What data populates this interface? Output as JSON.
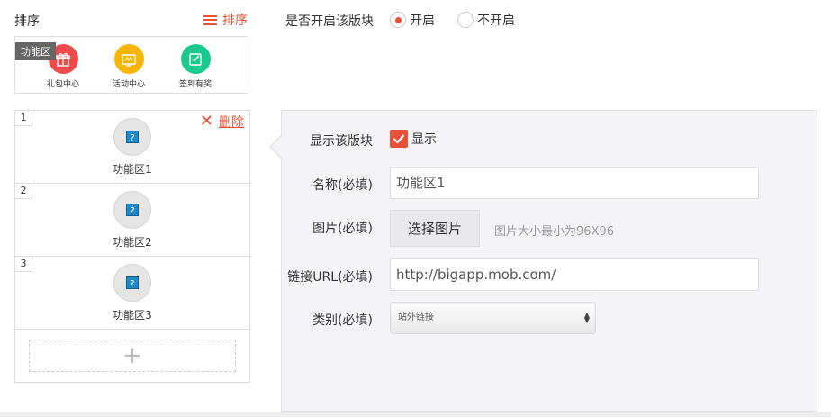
{
  "header": {
    "sort_title": "排序",
    "sort_button": "排序",
    "enable_label": "是否开启该版块",
    "radio_on": "开启",
    "radio_off": "不开启"
  },
  "preview": {
    "tag": "功能区",
    "items": [
      {
        "label": "礼包中心",
        "color": "#f04a4a",
        "icon": "gift-icon"
      },
      {
        "label": "活动中心",
        "color": "#f7b500",
        "icon": "activity-icon"
      },
      {
        "label": "签到有奖",
        "color": "#1bc98e",
        "icon": "edit-icon"
      }
    ]
  },
  "list": {
    "delete_label": "删除",
    "items": [
      {
        "num": "1",
        "name": "功能区1"
      },
      {
        "num": "2",
        "name": "功能区2"
      },
      {
        "num": "3",
        "name": "功能区3"
      }
    ],
    "add_symbol": "+"
  },
  "form": {
    "show_label": "显示该版块",
    "show_checkbox": "显示",
    "name_label": "名称(必填)",
    "name_value": "功能区1",
    "image_label": "图片(必填)",
    "choose_button": "选择图片",
    "image_hint": "图片大小最小为96X96",
    "url_label": "链接URL(必填)",
    "url_value": "http://bigapp.mob.com/",
    "category_label": "类别(必填)",
    "category_value": "站外链接"
  },
  "colors": {
    "accent": "#e8503a",
    "panel_bg": "#f4f4f7"
  }
}
